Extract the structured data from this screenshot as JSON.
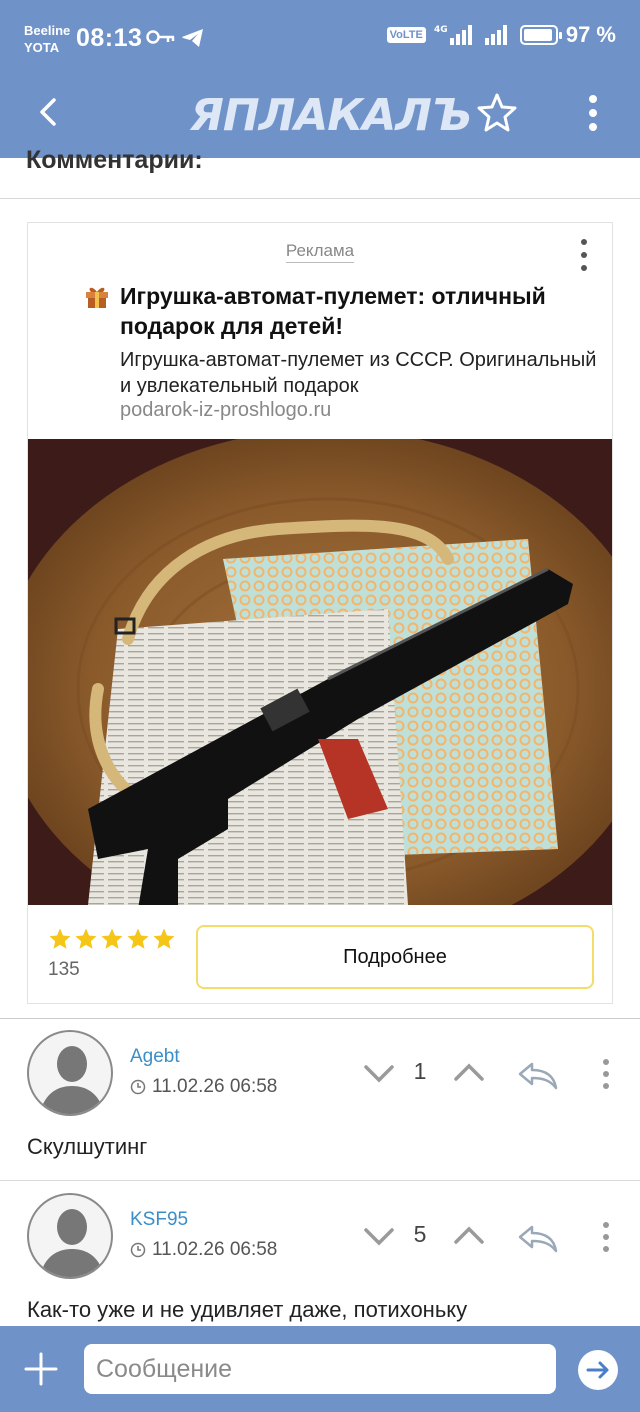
{
  "status_bar": {
    "carrier1": "Beeline",
    "carrier2": "YOTA",
    "time": "08:13",
    "volte": "VoLTE",
    "network": "4G",
    "battery": "97 %",
    "battery_level": 0.97
  },
  "app_bar": {
    "logo": "ЯПЛАКАЛЪ"
  },
  "comments_title": "Комментарии:",
  "ad": {
    "label": "Реклама",
    "title": "Игрушка-автомат-пулемет: отличный подарок для детей!",
    "description": "Игрушка-автомат-пулемет из СССР. Оригинальный и увлекательный подарок",
    "url": "podarok-iz-proshlogo.ru",
    "rating_stars": 5,
    "rating_count": "135",
    "button_label": "Подробнее",
    "colors": {
      "button_border": "#f2dd6a",
      "star": "#f5c518"
    }
  },
  "comments": [
    {
      "author": "Agebt",
      "date": "11.02.26 06:58",
      "votes": "1",
      "text": "Скулшутинг"
    },
    {
      "author": "KSF95",
      "date": "11.02.26 06:58",
      "votes": "5",
      "text": "Как-то уже и не удивляет даже, потихоньку"
    }
  ],
  "message_bar": {
    "placeholder": "Сообщение"
  },
  "colors": {
    "header": "#6f92c9",
    "author_link": "#3b8ec9"
  }
}
